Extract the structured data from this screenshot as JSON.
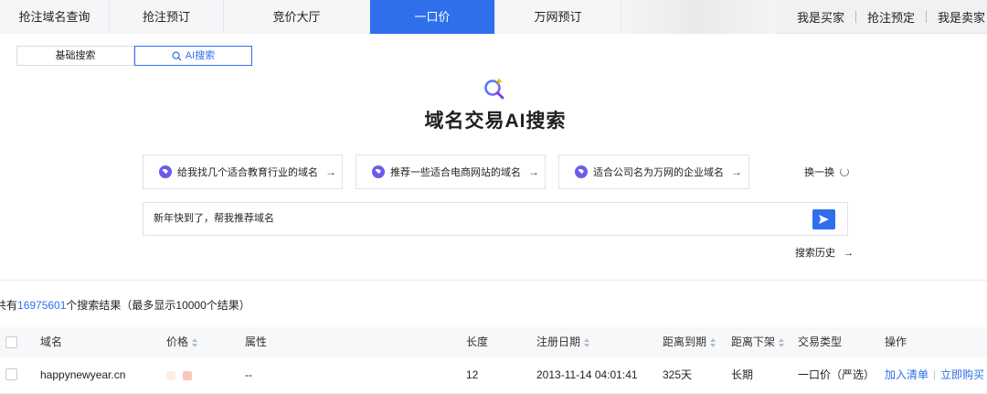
{
  "topnav": {
    "tabs": [
      {
        "label": "抢注域名查询",
        "active": false
      },
      {
        "label": "抢注预订",
        "active": false
      },
      {
        "label": "竞价大厅",
        "active": false
      },
      {
        "label": "一口价",
        "active": true
      },
      {
        "label": "万网预订",
        "active": false
      }
    ],
    "right_links": [
      "我是买家",
      "抢注预定",
      "我是卖家"
    ]
  },
  "search_modes": {
    "basic": "基础搜索",
    "ai": "AI搜索",
    "active": "ai"
  },
  "hero": {
    "title": "域名交易AI搜索",
    "icon": "ai-sparkle-search-icon"
  },
  "suggestions": [
    "给我找几个适合教育行业的域名",
    "推荐一些适合电商网站的域名",
    "适合公司名为万网的企业域名"
  ],
  "shuffle_label": "换一换",
  "query": {
    "value": "新年快到了，帮我推荐域名"
  },
  "history_label": "搜索历史",
  "results": {
    "prefix": "共有",
    "count": "16975601",
    "suffix": "个搜索结果（最多显示10000个结果）"
  },
  "table": {
    "headers": {
      "domain": "域名",
      "price": "价格",
      "attribute": "属性",
      "length": "长度",
      "reg_date": "注册日期",
      "expire": "距离到期",
      "delist": "距离下架",
      "trade_type": "交易类型",
      "actions": "操作"
    },
    "rows": [
      {
        "domain": "happynewyear.cn",
        "attribute": "--",
        "length": "12",
        "reg_date": "2013-11-14 04:01:41",
        "expire": "325天",
        "delist": "长期",
        "trade_type": "一口价（严选）",
        "action_add": "加入清单",
        "action_buy": "立即购买"
      }
    ]
  },
  "colors": {
    "accent": "#2f6fec",
    "tag": "#6c5ce7"
  }
}
